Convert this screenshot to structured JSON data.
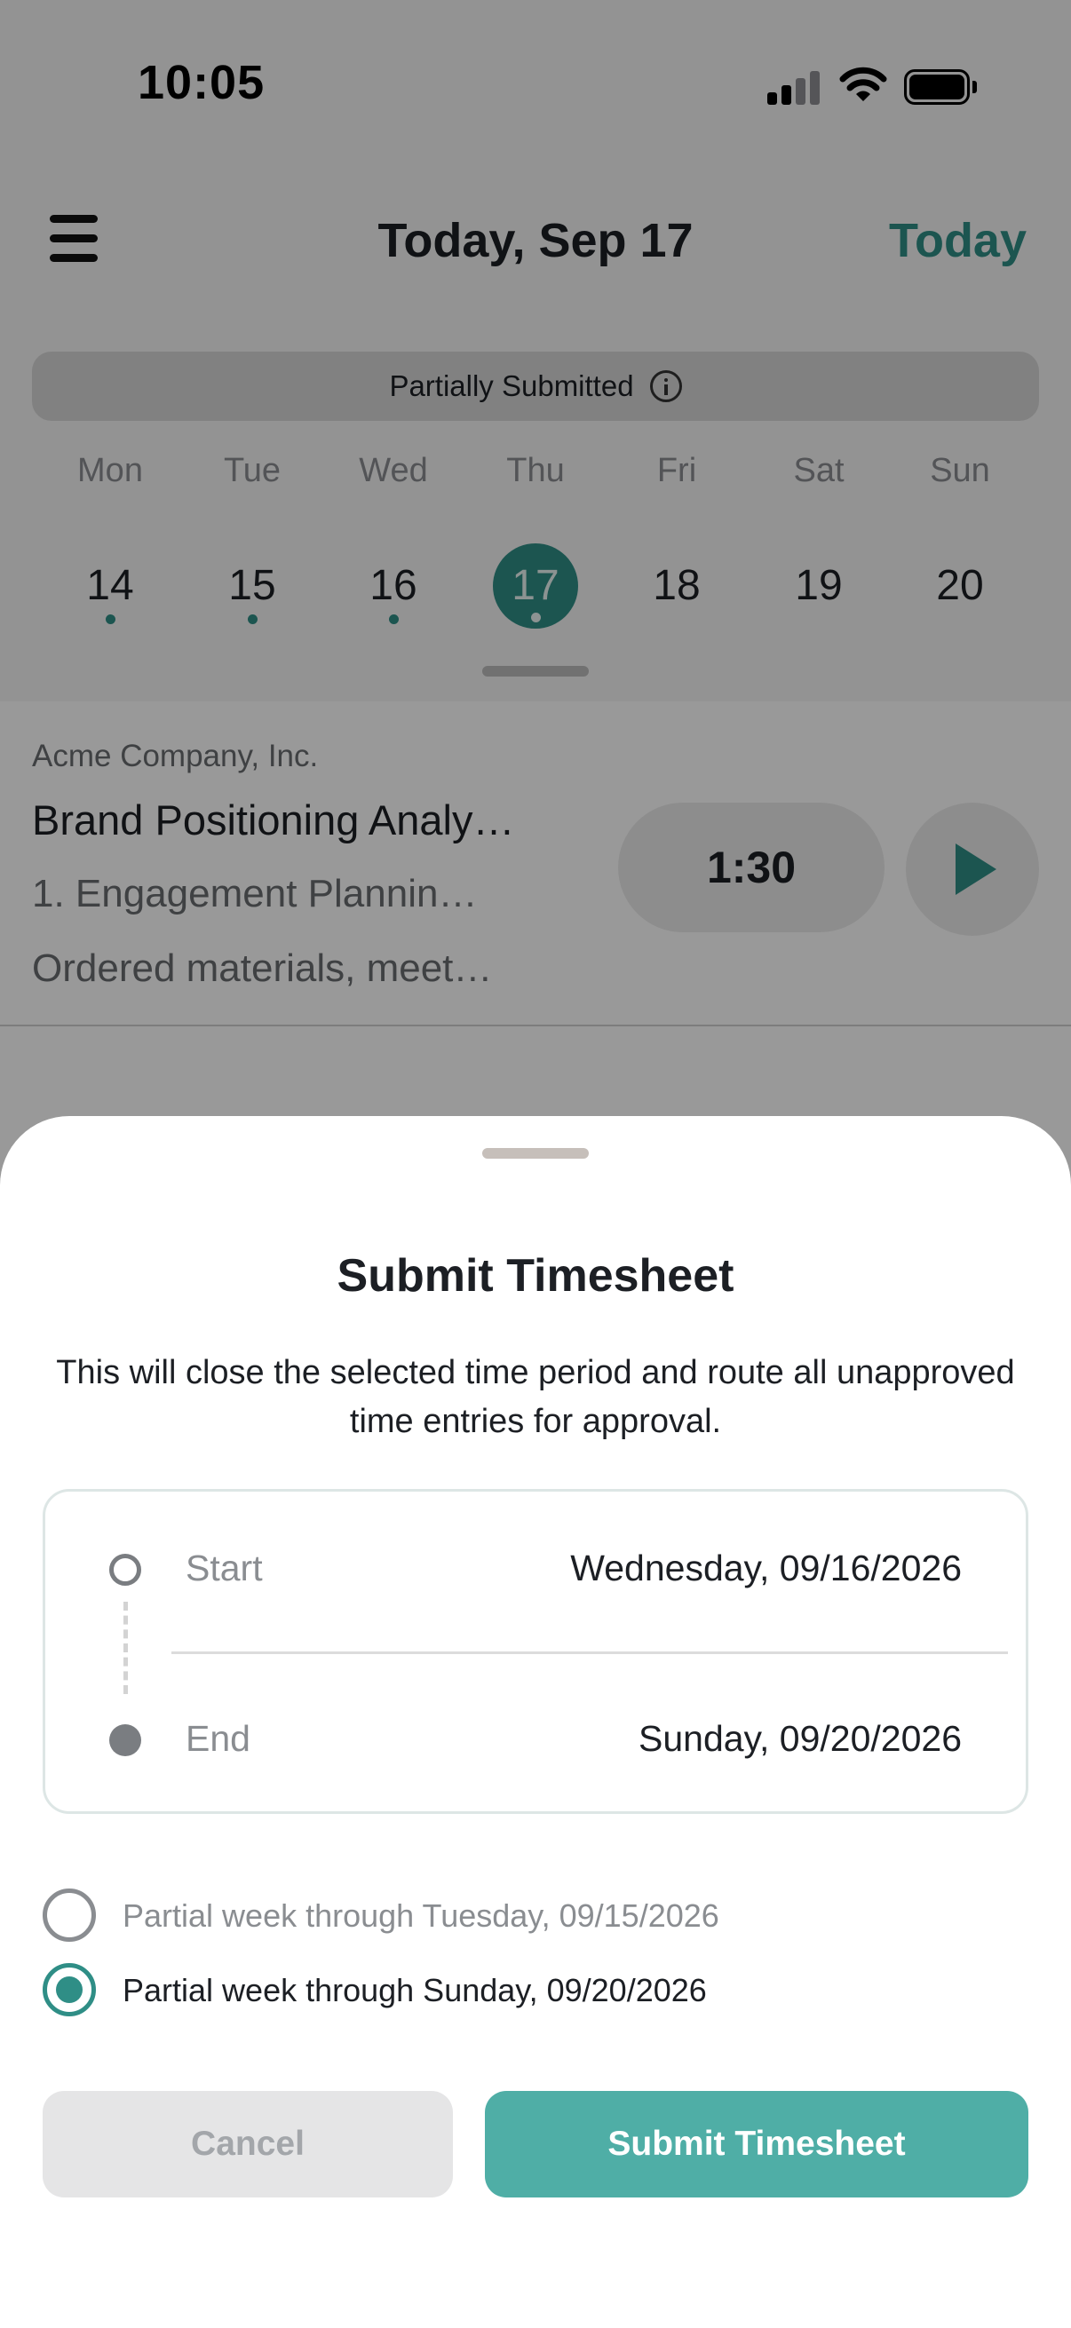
{
  "status_bar": {
    "time": "10:05"
  },
  "header": {
    "title": "Today, Sep 17",
    "today_link": "Today"
  },
  "status_pill": {
    "label": "Partially Submitted"
  },
  "week": {
    "days": [
      {
        "name": "Mon",
        "num": "14",
        "has_entries": true,
        "selected": false
      },
      {
        "name": "Tue",
        "num": "15",
        "has_entries": true,
        "selected": false
      },
      {
        "name": "Wed",
        "num": "16",
        "has_entries": true,
        "selected": false
      },
      {
        "name": "Thu",
        "num": "17",
        "has_entries": true,
        "selected": true
      },
      {
        "name": "Fri",
        "num": "18",
        "has_entries": false,
        "selected": false
      },
      {
        "name": "Sat",
        "num": "19",
        "has_entries": false,
        "selected": false
      },
      {
        "name": "Sun",
        "num": "20",
        "has_entries": false,
        "selected": false
      }
    ]
  },
  "entry": {
    "company": "Acme Company, Inc.",
    "project": "Brand Positioning Analy…",
    "task": "1. Engagement Plannin…",
    "note": "Ordered materials, meet…",
    "duration": "1:30"
  },
  "sheet": {
    "title": "Submit Timesheet",
    "description": "This will close the selected time period and route all unapproved time entries for approval.",
    "start_label": "Start",
    "start_value": "Wednesday, 09/16/2026",
    "end_label": "End",
    "end_value": "Sunday, 09/20/2026",
    "options": [
      {
        "label": "Partial week through Tuesday, 09/15/2026",
        "checked": false
      },
      {
        "label": "Partial week through Sunday, 09/20/2026",
        "checked": true
      }
    ],
    "cancel_label": "Cancel",
    "submit_label": "Submit Timesheet"
  },
  "colors": {
    "accent": "#2f8e86",
    "submit_button": "#4faea6"
  }
}
